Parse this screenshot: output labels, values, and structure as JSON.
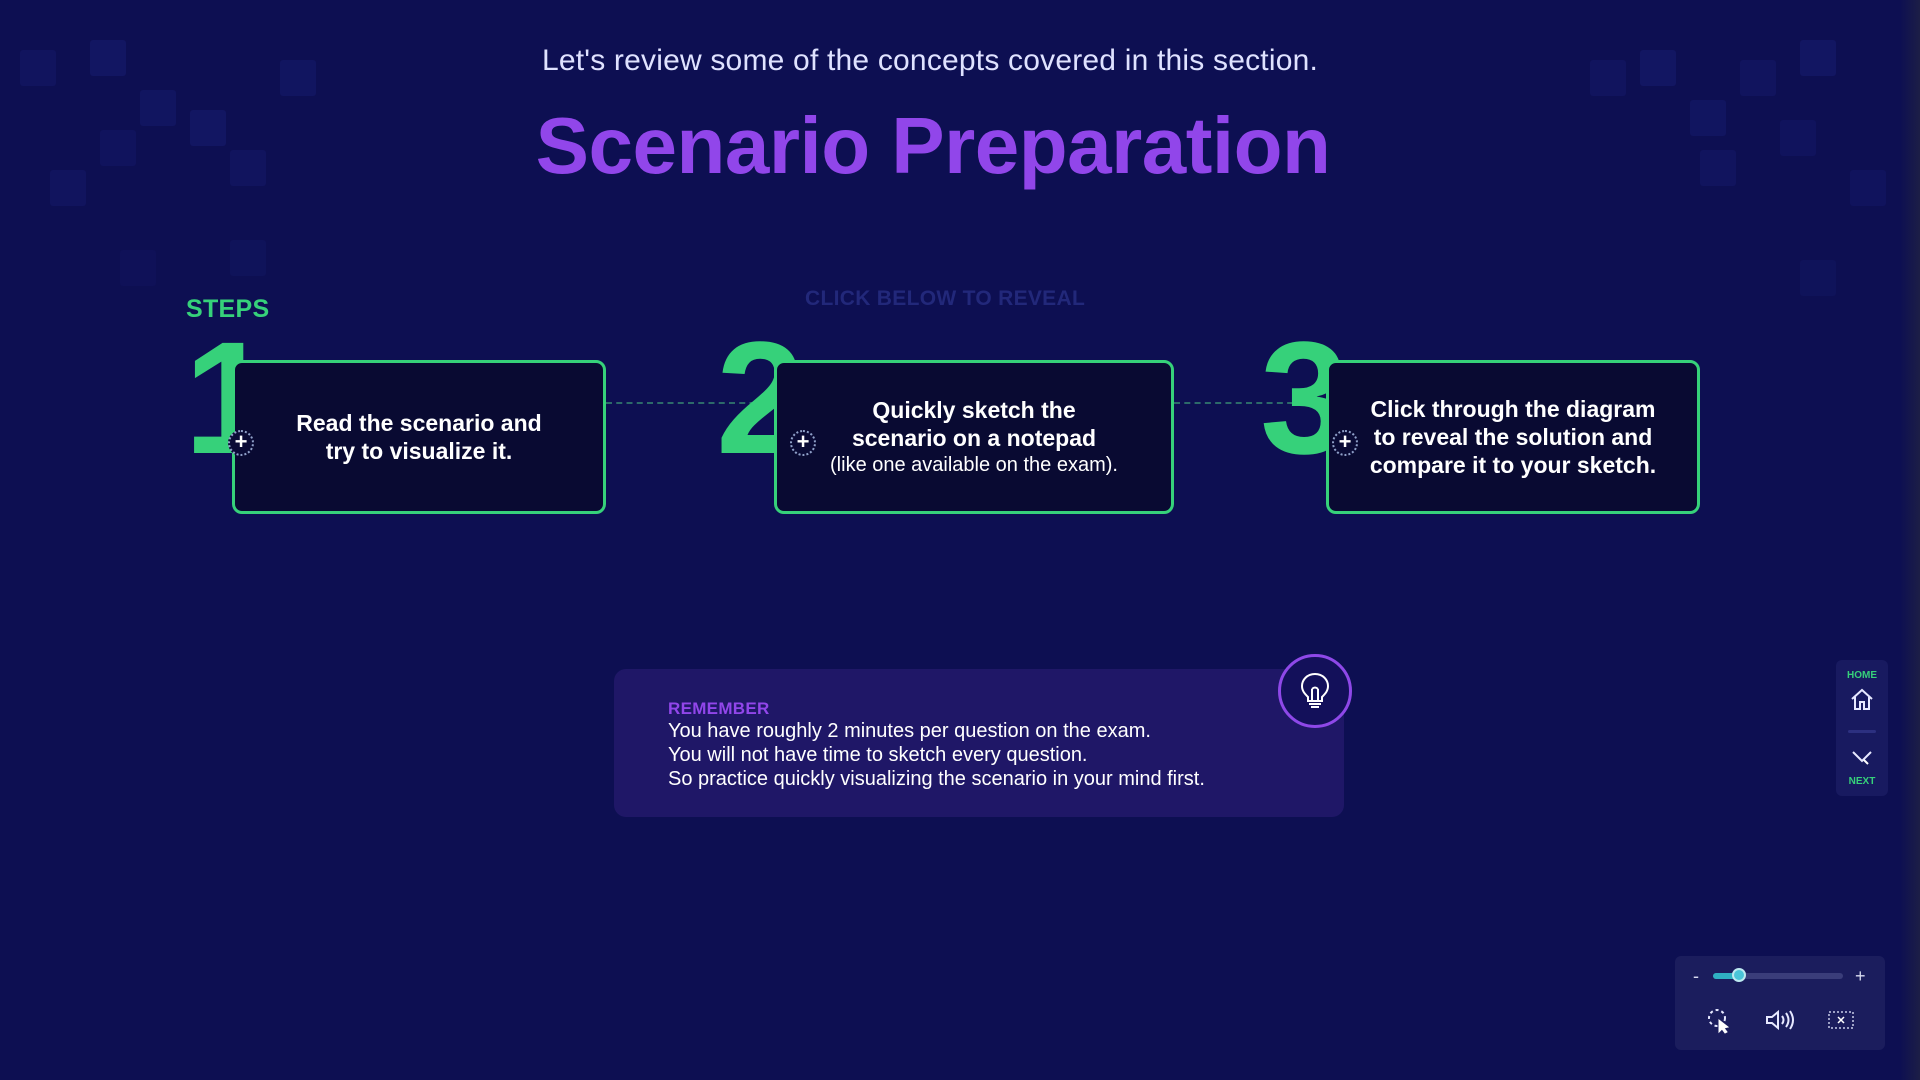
{
  "header": {
    "intro": "Let's review some of the concepts covered in this section.",
    "title": "Scenario Preparation"
  },
  "steps_section": {
    "label": "STEPS",
    "hint": "CLICK BELOW TO REVEAL",
    "steps": [
      {
        "number": "1",
        "bold": "Read the scenario and try to visualize it.",
        "sub": ""
      },
      {
        "number": "2",
        "bold": "Quickly sketch the scenario on a notepad",
        "sub": "(like one available on the exam)."
      },
      {
        "number": "3",
        "bold": "Click through the diagram to reveal the solution and compare it to your sketch.",
        "sub": ""
      }
    ]
  },
  "remember": {
    "heading": "REMEMBER",
    "lines": [
      "You have roughly 2 minutes per question on the exam.",
      "You will not have time to sketch every question.",
      "So practice quickly visualizing the scenario in your mind first."
    ]
  },
  "nav": {
    "home_label": "HOME",
    "next_label": "NEXT"
  },
  "player_controls": {
    "zoom_minus": "-",
    "zoom_plus": "+",
    "zoom_level": 0.2
  },
  "colors": {
    "background": "#0d0f52",
    "accent_green": "#36d17a",
    "accent_purple": "#9146ea"
  },
  "icons": [
    "plus-icon",
    "lightbulb-icon",
    "home-icon",
    "next-icon",
    "cursor-icon",
    "volume-icon",
    "close-icon"
  ]
}
